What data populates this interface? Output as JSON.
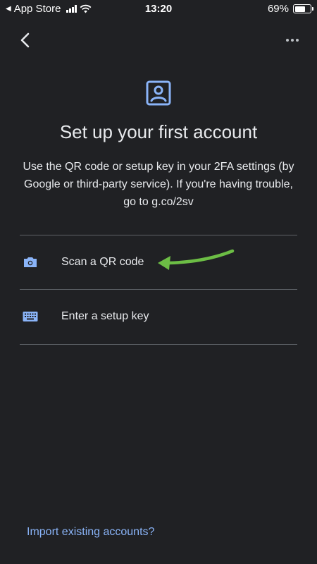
{
  "status_bar": {
    "carrier": "App Store",
    "time": "13:20",
    "battery": "69%",
    "battery_level": 0.69
  },
  "header": {
    "back_icon": "chevron-left-icon",
    "more_icon": "more-horizontal-icon"
  },
  "main": {
    "hero_icon": "account-box-icon",
    "title": "Set up your first account",
    "description": "Use the QR code or setup key in your 2FA settings (by Google or third-party service). If you're having trouble, go to g.co/2sv",
    "options": [
      {
        "label": "Scan a QR code",
        "icon": "camera-icon"
      },
      {
        "label": "Enter a setup key",
        "icon": "keyboard-icon"
      }
    ]
  },
  "footer": {
    "import_link": "Import existing accounts?"
  },
  "colors": {
    "background": "#202124",
    "accent": "#8ab4f8",
    "annotation_arrow": "#6cbd45"
  }
}
